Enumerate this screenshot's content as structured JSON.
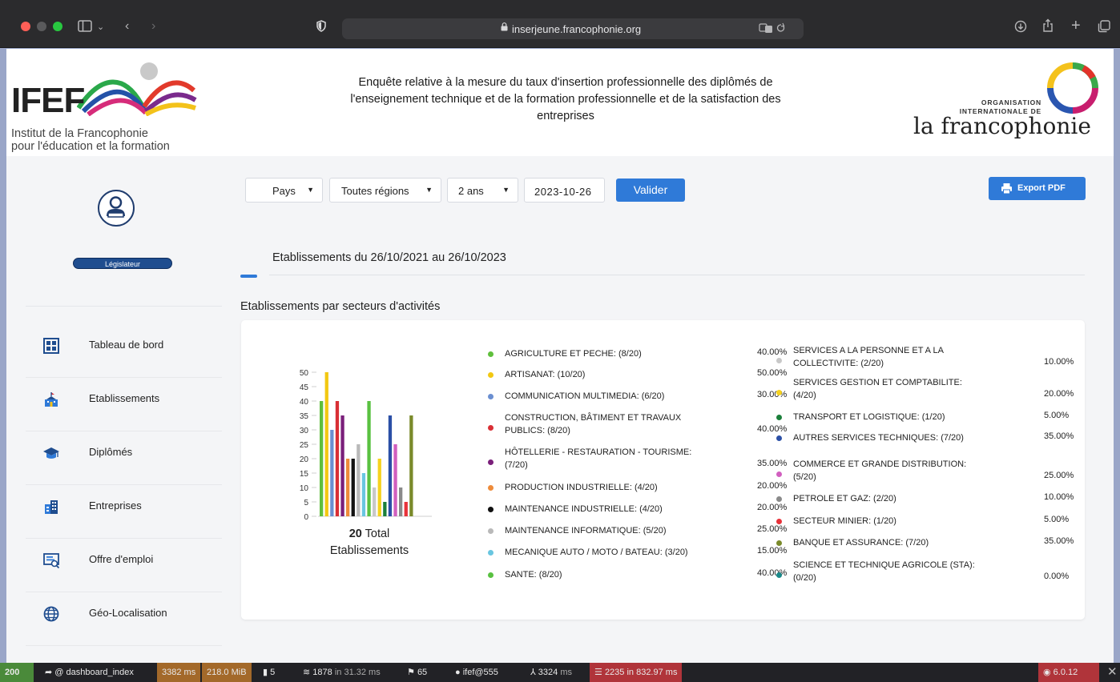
{
  "browser": {
    "url": "inserjeune.francophonie.org"
  },
  "header": {
    "ifef_acronym": "IFEF",
    "ifef_line1": "Institut de la Francophonie",
    "ifef_line2": "pour l'éducation et la formation",
    "survey_title": "Enquête relative à la mesure du taux d'insertion professionnelle des diplômés de l'enseignement technique et de la formation professionnelle et de la satisfaction des entreprises",
    "oif_line1": "ORGANISATION",
    "oif_line2": "INTERNATIONALE DE",
    "oif_word": "la francophonie"
  },
  "sidebar": {
    "role": "Législateur",
    "items": [
      {
        "label": "Tableau de bord",
        "icon": "dashboard-icon"
      },
      {
        "label": "Etablissements",
        "icon": "school-icon"
      },
      {
        "label": "Diplômés",
        "icon": "graduation-cap-icon"
      },
      {
        "label": "Entreprises",
        "icon": "building-icon"
      },
      {
        "label": "Offre d'emploi",
        "icon": "job-offer-icon"
      },
      {
        "label": "Géo-Localisation",
        "icon": "globe-icon"
      }
    ]
  },
  "filters": {
    "country": "Pays",
    "region": "Toutes régions",
    "period": "2 ans",
    "date": "2023-10-26",
    "validate": "Valider",
    "export": "Export PDF"
  },
  "period_title": "Etablissements du 26/10/2021 au 26/10/2023",
  "sector_title": "Etablissements par secteurs d'activités",
  "total": {
    "count": "20",
    "label": "Total",
    "label2": "Etablissements"
  },
  "sectors": [
    {
      "label": "AGRICULTURE ET PECHE: (8/20)",
      "pct": "40.00%",
      "value": 40,
      "color": "#5fbf3c"
    },
    {
      "label": "ARTISANAT: (10/20)",
      "pct": "50.00%",
      "value": 50,
      "color": "#f2c812"
    },
    {
      "label": "COMMUNICATION MULTIMEDIA: (6/20)",
      "pct": "30.00%",
      "value": 30,
      "color": "#6b8fd1"
    },
    {
      "label": "CONSTRUCTION, BÂTIMENT ET TRAVAUX PUBLICS: (8/20)",
      "pct": "40.00%",
      "value": 40,
      "color": "#d92f35"
    },
    {
      "label": "HÔTELLERIE - RESTAURATION - TOURISME: (7/20)",
      "pct": "35.00%",
      "value": 35,
      "color": "#7a1f7a"
    },
    {
      "label": "PRODUCTION INDUSTRIELLE: (4/20)",
      "pct": "20.00%",
      "value": 20,
      "color": "#ee8b3a"
    },
    {
      "label": "MAINTENANCE INDUSTRIELLE: (4/20)",
      "pct": "20.00%",
      "value": 20,
      "color": "#111111"
    },
    {
      "label": "MAINTENANCE INFORMATIQUE: (5/20)",
      "pct": "25.00%",
      "value": 25,
      "color": "#b9b9b9"
    },
    {
      "label": "MECANIQUE AUTO / MOTO / BATEAU: (3/20)",
      "pct": "15.00%",
      "value": 15,
      "color": "#69c6e0"
    },
    {
      "label": "SANTE: (8/20)",
      "pct": "40.00%",
      "value": 40,
      "color": "#59c141"
    },
    {
      "label": "SERVICES A LA PERSONNE ET A LA COLLECTIVITE: (2/20)",
      "pct": "10.00%",
      "value": 10,
      "color": "#c8c8c8"
    },
    {
      "label": "SERVICES GESTION ET COMPTABILITE: (4/20)",
      "pct": "20.00%",
      "value": 20,
      "color": "#f6d21e"
    },
    {
      "label": "TRANSPORT ET LOGISTIQUE: (1/20)",
      "pct": "5.00%",
      "value": 5,
      "color": "#1b7f3a"
    },
    {
      "label": "AUTRES SERVICES TECHNIQUES: (7/20)",
      "pct": "35.00%",
      "value": 35,
      "color": "#2b4fa6"
    },
    {
      "label": "COMMERCE ET GRANDE DISTRIBUTION: (5/20)",
      "pct": "25.00%",
      "value": 25,
      "color": "#d15fbf"
    },
    {
      "label": "PETROLE ET GAZ: (2/20)",
      "pct": "10.00%",
      "value": 10,
      "color": "#8a8a8a"
    },
    {
      "label": "SECTEUR MINIER: (1/20)",
      "pct": "5.00%",
      "value": 5,
      "color": "#e8323a"
    },
    {
      "label": "BANQUE ET ASSURANCE: (7/20)",
      "pct": "35.00%",
      "value": 35,
      "color": "#7a8a2a"
    },
    {
      "label": "SCIENCE ET TECHNIQUE AGRICOLE (STA): (0/20)",
      "pct": "0.00%",
      "value": 0,
      "color": "#1a8a8a"
    }
  ],
  "chart_data": {
    "type": "bar",
    "categories": [
      "AGRICULTURE ET PECHE",
      "ARTISANAT",
      "COMMUNICATION MULTIMEDIA",
      "CONSTRUCTION, BÂTIMENT ET TRAVAUX PUBLICS",
      "HÔTELLERIE - RESTAURATION - TOURISME",
      "PRODUCTION INDUSTRIELLE",
      "MAINTENANCE INDUSTRIELLE",
      "MAINTENANCE INFORMATIQUE",
      "MECANIQUE AUTO / MOTO / BATEAU",
      "SANTE",
      "SERVICES A LA PERSONNE ET A LA COLLECTIVITE",
      "SERVICES GESTION ET COMPTABILITE",
      "TRANSPORT ET LOGISTIQUE",
      "AUTRES SERVICES TECHNIQUES",
      "COMMERCE ET GRANDE DISTRIBUTION",
      "PETROLE ET GAZ",
      "SECTEUR MINIER",
      "BANQUE ET ASSURANCE",
      "SCIENCE ET TECHNIQUE AGRICOLE (STA)"
    ],
    "values": [
      40,
      50,
      30,
      40,
      35,
      20,
      20,
      25,
      15,
      40,
      10,
      20,
      5,
      35,
      25,
      10,
      5,
      35,
      0
    ],
    "ylim": [
      0,
      50
    ],
    "yticks": [
      "0",
      "5",
      "10",
      "15",
      "20",
      "25",
      "30",
      "35",
      "40",
      "45",
      "50"
    ],
    "grid": false
  },
  "debug": {
    "status": "200",
    "route": "@ dashboard_index",
    "time": "3382 ms",
    "memory": "218.0 MiB",
    "logs": "5",
    "cache": "1878",
    "cache_time": "in 31.32 ms",
    "translations": "65",
    "user": "ifef@555",
    "twig": "3324",
    "twig_unit": "ms",
    "db": "2235 in 832.97 ms",
    "version": "6.0.12"
  }
}
